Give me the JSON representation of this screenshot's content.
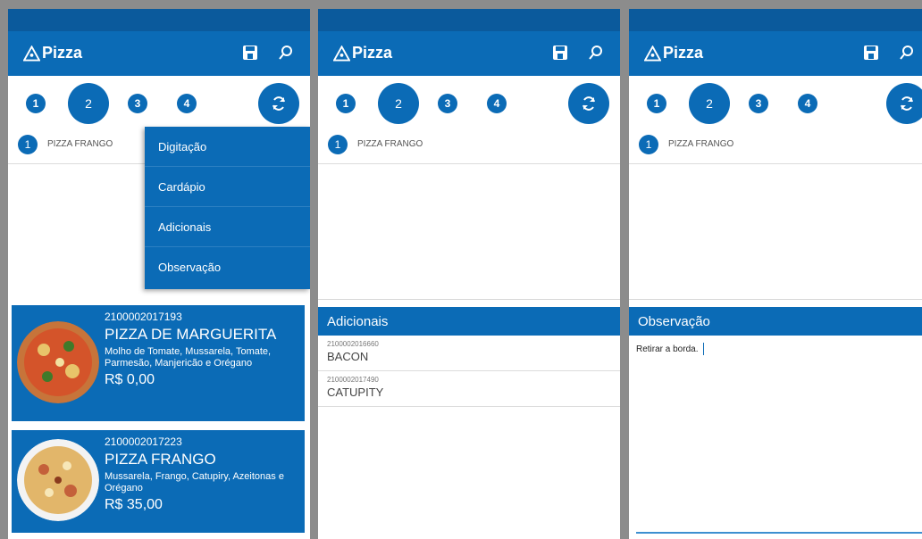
{
  "app": {
    "title": "Pizza"
  },
  "steps": [
    "1",
    "2",
    "3",
    "4"
  ],
  "order_item": {
    "number": "1",
    "name": "PIZZA FRANGO"
  },
  "menu": {
    "items": [
      "Digitação",
      "Cardápio",
      "Adicionais",
      "Observação"
    ]
  },
  "products": [
    {
      "code": "2100002017193",
      "name": "PIZZA DE MARGUERITA",
      "description": "Molho de Tomate, Mussarela, Tomate, Parmesão, Manjericão e Orégano",
      "price": "R$ 0,00"
    },
    {
      "code": "2100002017223",
      "name": "PIZZA FRANGO",
      "description": "Mussarela, Frango, Catupiry, Azeitonas e Orégano",
      "price": "R$ 35,00"
    }
  ],
  "adicionais": {
    "title": "Adicionais",
    "items": [
      {
        "code": "2100002016660",
        "name": "BACON"
      },
      {
        "code": "2100002017490",
        "name": "CATUPITY"
      }
    ]
  },
  "observacao": {
    "title": "Observação",
    "text": "Retirar a borda."
  },
  "colors": {
    "primary": "#0b6bb6",
    "statusbar": "#0b5a9c"
  }
}
